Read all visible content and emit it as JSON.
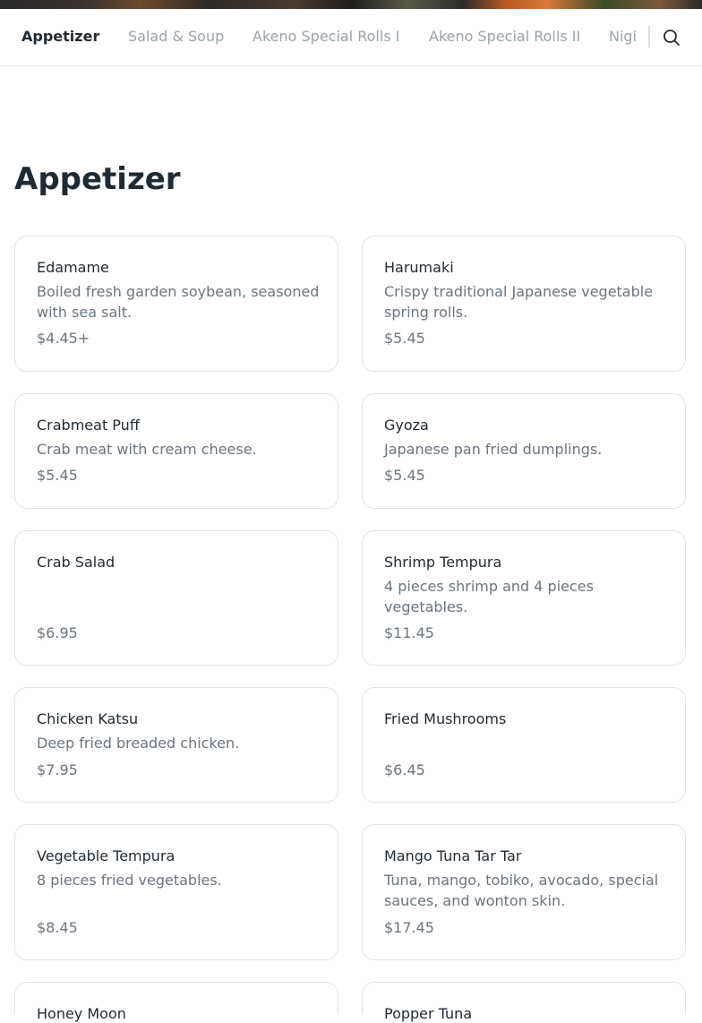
{
  "nav": {
    "tabs": [
      {
        "label": "Appetizer",
        "active": true
      },
      {
        "label": "Salad & Soup",
        "active": false
      },
      {
        "label": "Akeno Special Rolls I",
        "active": false
      },
      {
        "label": "Akeno Special Rolls II",
        "active": false
      },
      {
        "label": "Nigi",
        "active": false
      }
    ],
    "search_icon": "search-icon"
  },
  "section": {
    "title": "Appetizer",
    "items": [
      {
        "name": "Edamame",
        "desc": "Boiled fresh garden soybean, seasoned with sea salt.",
        "price": "$4.45+"
      },
      {
        "name": "Harumaki",
        "desc": "Crispy traditional Japanese vegetable spring rolls.",
        "price": "$5.45"
      },
      {
        "name": "Crabmeat Puff",
        "desc": "Crab meat with cream cheese.",
        "price": "$5.45"
      },
      {
        "name": "Gyoza",
        "desc": "Japanese pan fried dumplings.",
        "price": "$5.45"
      },
      {
        "name": "Crab Salad",
        "desc": "",
        "price": "$6.95"
      },
      {
        "name": "Shrimp Tempura",
        "desc": "4 pieces shrimp and 4 pieces vegetables.",
        "price": "$11.45"
      },
      {
        "name": "Chicken Katsu",
        "desc": "Deep fried breaded chicken.",
        "price": "$7.95"
      },
      {
        "name": "Fried Mushrooms",
        "desc": "",
        "price": "$6.45"
      },
      {
        "name": "Vegetable Tempura",
        "desc": "8 pieces fried vegetables.",
        "price": "$8.45"
      },
      {
        "name": "Mango Tuna Tar Tar",
        "desc": "Tuna, mango, tobiko, avocado, special sauces, and wonton skin.",
        "price": "$17.45"
      },
      {
        "name": "Honey Moon",
        "desc": "",
        "price": ""
      },
      {
        "name": "Popper Tuna",
        "desc": "",
        "price": ""
      }
    ]
  }
}
